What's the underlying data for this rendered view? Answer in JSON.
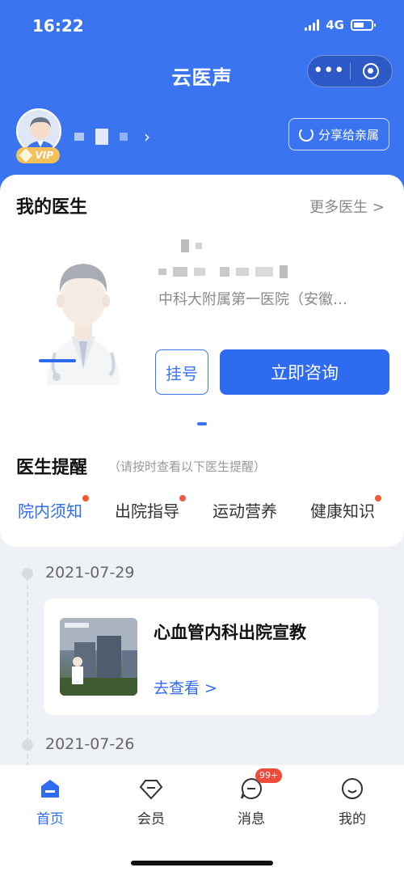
{
  "status_bar": {
    "time": "16:22",
    "network": "4G"
  },
  "app": {
    "title": "云医声"
  },
  "profile": {
    "vip_label": "VIP",
    "share_label": "分享给亲属"
  },
  "my_doctor": {
    "title": "我的医生",
    "more_label": "更多医生 >",
    "hospital": "中科大附属第一医院（安徽…",
    "register_label": "挂号",
    "consult_label": "立即咨询"
  },
  "reminder": {
    "title": "医生提醒",
    "subtitle": "（请按时查看以下医生提醒）",
    "tabs": [
      {
        "label": "院内须知"
      },
      {
        "label": "出院指导"
      },
      {
        "label": "运动营养"
      },
      {
        "label": "健康知识"
      }
    ]
  },
  "timeline": [
    {
      "date": "2021-07-29",
      "article_title": "心血管内科出院宣教",
      "article_link": "去查看 >"
    },
    {
      "date": "2021-07-26"
    }
  ],
  "tabbar": {
    "items": [
      {
        "label": "首页"
      },
      {
        "label": "会员"
      },
      {
        "label": "消息",
        "badge": "99+"
      },
      {
        "label": "我的"
      }
    ]
  },
  "colors": {
    "brand": "#3a74f0",
    "accent_red": "#ef5b3a"
  }
}
